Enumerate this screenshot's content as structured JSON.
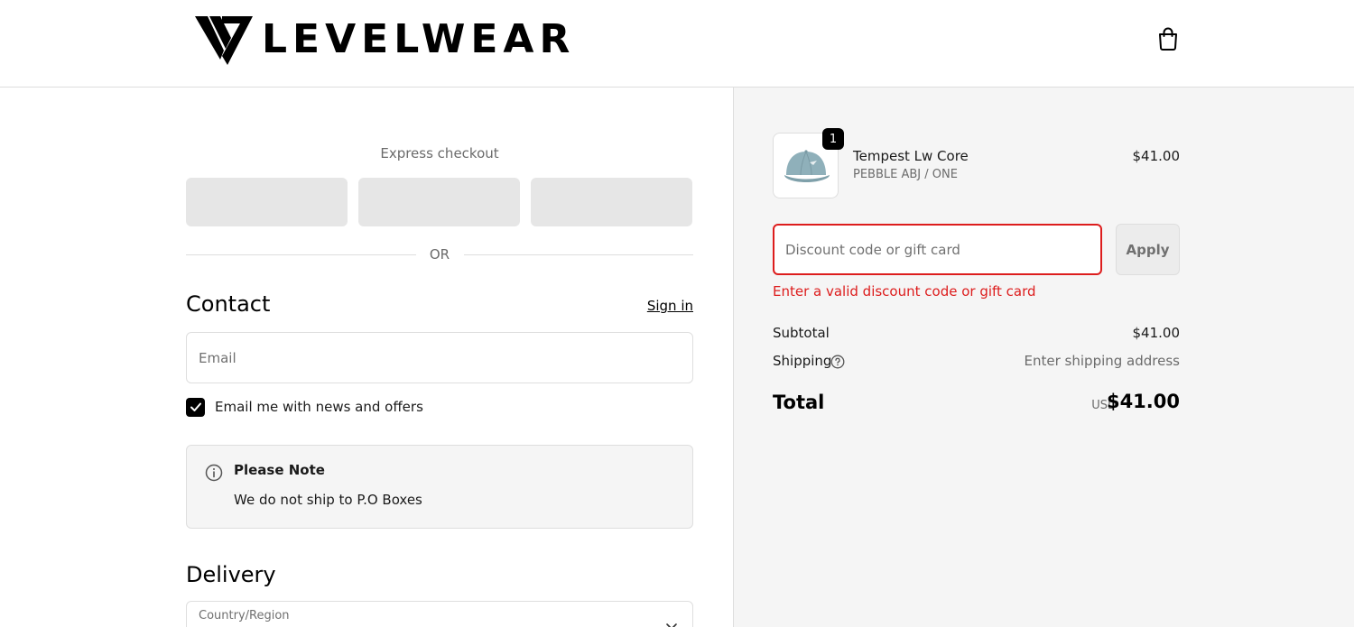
{
  "header": {
    "brand": "LEVELWEAR"
  },
  "express": {
    "title": "Express checkout",
    "separator": "OR"
  },
  "contact": {
    "title": "Contact",
    "sign_in": "Sign in",
    "email_placeholder": "Email",
    "newsletter_label": "Email me with news and offers",
    "newsletter_checked": true
  },
  "note": {
    "title": "Please Note",
    "body": "We do not ship to P.O Boxes"
  },
  "delivery": {
    "title": "Delivery",
    "country_label": "Country/Region"
  },
  "order": {
    "item": {
      "quantity": "1",
      "name": "Tempest Lw Core",
      "variant": "PEBBLE ABJ / ONE",
      "price": "$41.00"
    },
    "discount_placeholder": "Discount code or gift card",
    "apply_label": "Apply",
    "discount_error": "Enter a valid discount code or gift card",
    "subtotal_label": "Subtotal",
    "subtotal_value": "$41.00",
    "shipping_label": "Shipping",
    "shipping_value": "Enter shipping address",
    "total_label": "Total",
    "total_currency": "USD",
    "total_value": "$41.00"
  },
  "colors": {
    "error": "#dd1d1d",
    "summary_bg": "#f5f5f5",
    "cap_color": "#8fb0ba"
  }
}
